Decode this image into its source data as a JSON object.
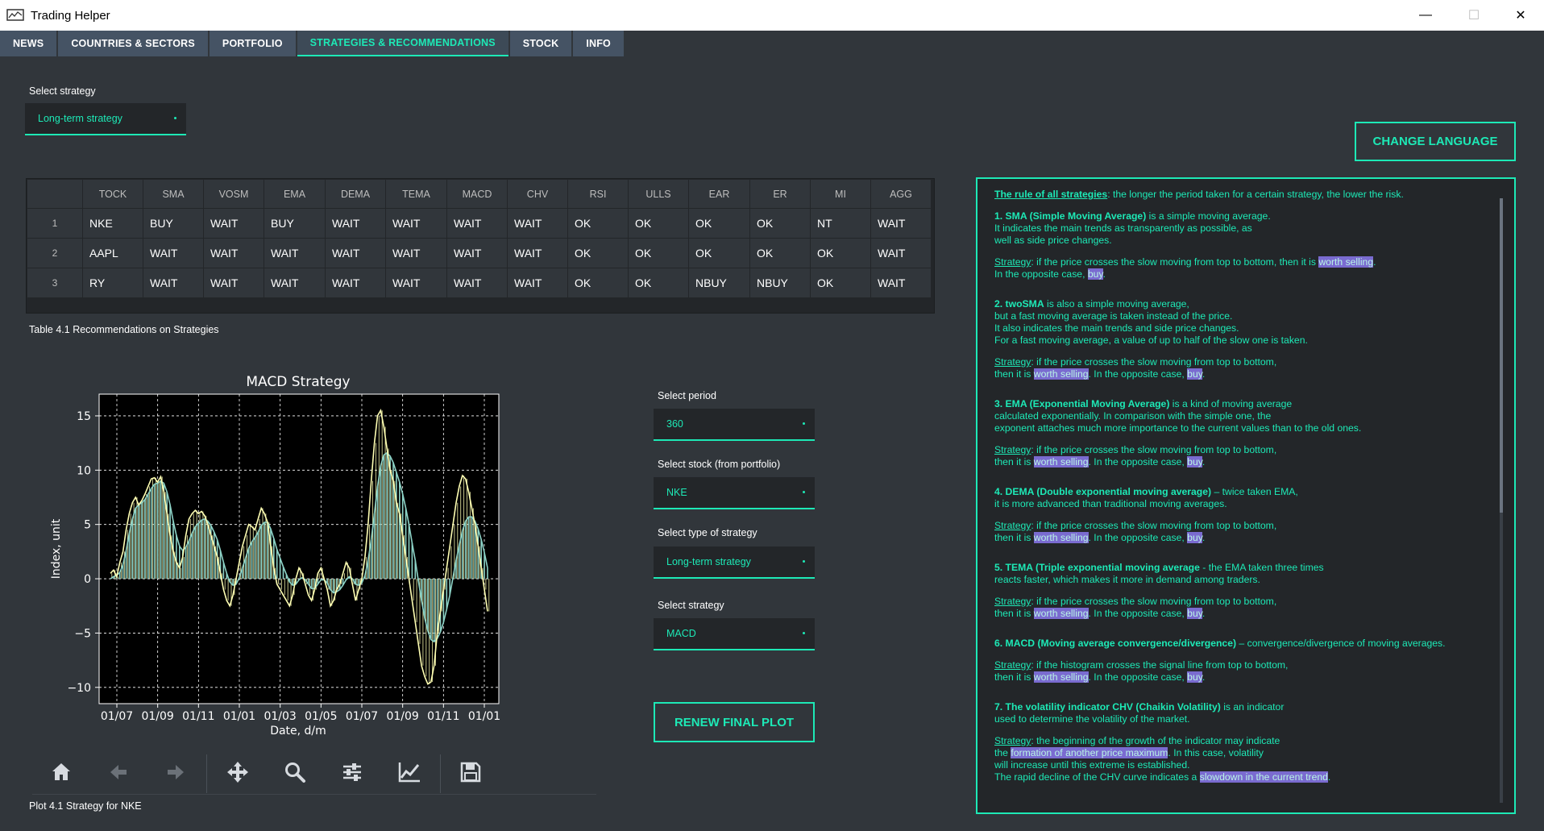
{
  "window": {
    "title": "Trading Helper",
    "controls": [
      "—",
      "☐",
      "✕"
    ]
  },
  "tabs": [
    {
      "label": "NEWS"
    },
    {
      "label": "COUNTRIES & SECTORS"
    },
    {
      "label": "PORTFOLIO"
    },
    {
      "label": "STRATEGIES & RECOMMENDATIONS"
    },
    {
      "label": "STOCK"
    },
    {
      "label": "INFO"
    }
  ],
  "strategy_selector": {
    "label": "Select strategy",
    "value": "Long-term strategy"
  },
  "table": {
    "headers": [
      "TOCK",
      "SMA",
      "VOSM",
      "EMA",
      "DEMA",
      "TEMA",
      "MACD",
      "CHV",
      "RSI",
      "ULLS",
      "EAR",
      "ER",
      "MI",
      "AGG"
    ],
    "rows": [
      {
        "num": "1",
        "cells": [
          "NKE",
          "BUY",
          "WAIT",
          "BUY",
          "WAIT",
          "WAIT",
          "WAIT",
          "WAIT",
          "OK",
          "OK",
          "OK",
          "OK",
          "NT",
          "WAIT"
        ]
      },
      {
        "num": "2",
        "cells": [
          "AAPL",
          "WAIT",
          "WAIT",
          "WAIT",
          "WAIT",
          "WAIT",
          "WAIT",
          "WAIT",
          "OK",
          "OK",
          "OK",
          "OK",
          "OK",
          "WAIT"
        ]
      },
      {
        "num": "3",
        "cells": [
          "RY",
          "WAIT",
          "WAIT",
          "WAIT",
          "WAIT",
          "WAIT",
          "WAIT",
          "WAIT",
          "OK",
          "OK",
          "NBUY",
          "NBUY",
          "OK",
          "WAIT"
        ]
      }
    ],
    "caption": "Table 4.1 Recommendations on Strategies"
  },
  "chart_data": {
    "type": "line",
    "title": "MACD Strategy",
    "xlabel": "Date, d/m",
    "ylabel": "Index, unit",
    "x_ticks": [
      "01/07",
      "01/09",
      "01/11",
      "01/01",
      "01/03",
      "01/05",
      "01/07",
      "01/09",
      "01/11",
      "01/01"
    ],
    "y_ticks": [
      15,
      10,
      5,
      0,
      -5,
      -10
    ],
    "ylim": [
      -11.5,
      17
    ],
    "grid": true,
    "background": "#000000",
    "series": [
      {
        "color": "#ffffb3",
        "values": [
          0.5,
          0.8,
          0.2,
          1.5,
          2.5,
          4.5,
          6.0,
          7.0,
          7.5,
          6.8,
          7.2,
          7.8,
          8.5,
          9.2,
          9.3,
          8.9,
          9.4,
          8.0,
          6.0,
          4.0,
          2.5,
          1.5,
          1.0,
          2.0,
          4.0,
          5.5,
          6.0,
          6.3,
          6.0,
          6.2,
          5.8,
          5.0,
          4.0,
          3.0,
          2.0,
          0.5,
          -1.0,
          -2.0,
          -2.5,
          -1.5,
          0.0,
          1.5,
          3.0,
          4.0,
          5.0,
          4.8,
          4.5,
          5.5,
          6.5,
          6.0,
          5.2,
          3.0,
          1.0,
          -0.5,
          -1.0,
          -1.5,
          -2.0,
          -2.5,
          -1.5,
          0.0,
          1.0,
          0.5,
          -0.5,
          -1.5,
          -2.0,
          -1.0,
          0.5,
          1.0,
          0.0,
          -1.0,
          -2.5,
          -2.0,
          -1.0,
          -0.5,
          0.5,
          1.5,
          1.0,
          -0.5,
          -2.0,
          -1.0,
          0.0,
          2.0,
          5.0,
          9.0,
          12.5,
          15.0,
          15.5,
          14.0,
          12.0,
          10.0,
          9.0,
          7.0,
          6.0,
          4.0,
          2.0,
          0.0,
          -2.0,
          -4.0,
          -6.0,
          -8.0,
          -9.0,
          -9.7,
          -9.5,
          -8.0,
          -5.0,
          -3.0,
          -1.0,
          1.0,
          3.0,
          5.0,
          7.0,
          8.5,
          9.5,
          9.2,
          8.0,
          6.5,
          5.0,
          3.0,
          1.0,
          -1.0,
          -3.0
        ]
      },
      {
        "color": "#8dd3c7",
        "values": [
          0.0,
          0.2,
          0.3,
          0.6,
          1.3,
          2.6,
          4.2,
          5.5,
          6.5,
          6.8,
          7.0,
          7.3,
          7.8,
          8.3,
          8.7,
          8.8,
          9.0,
          8.8,
          8.0,
          6.8,
          5.3,
          4.0,
          3.0,
          2.6,
          2.9,
          3.5,
          4.2,
          4.8,
          5.1,
          5.4,
          5.5,
          5.3,
          4.9,
          4.3,
          3.6,
          2.6,
          1.5,
          0.5,
          -0.3,
          -0.6,
          -0.5,
          0.1,
          1.0,
          1.9,
          2.8,
          3.4,
          3.8,
          4.3,
          4.9,
          5.2,
          5.2,
          4.6,
          3.7,
          2.7,
          1.9,
          1.1,
          0.4,
          -0.3,
          -0.6,
          -0.5,
          -0.1,
          0.1,
          -0.1,
          -0.5,
          -0.9,
          -0.9,
          -0.5,
          -0.1,
          -0.1,
          -0.4,
          -1.0,
          -1.3,
          -1.2,
          -1.0,
          -0.6,
          -0.1,
          0.2,
          0.0,
          -0.5,
          -0.6,
          -0.4,
          0.3,
          1.7,
          3.6,
          6.0,
          8.5,
          10.4,
          11.4,
          11.6,
          11.3,
          10.7,
          9.8,
          8.9,
          7.8,
          6.5,
          5.0,
          3.3,
          1.7,
          -0.2,
          -2.0,
          -3.6,
          -4.8,
          -5.6,
          -5.8,
          -5.5,
          -4.9,
          -4.0,
          -2.8,
          -1.5,
          0.1,
          1.7,
          3.1,
          4.4,
          5.3,
          5.7,
          5.7,
          5.3,
          4.6,
          3.6,
          2.4,
          1.0
        ]
      }
    ]
  },
  "controls": {
    "period": {
      "label": "Select period",
      "value": "360"
    },
    "stock": {
      "label": "Select stock (from portfolio)",
      "value": "NKE"
    },
    "type": {
      "label": "Select type of strategy",
      "value": "Long-term strategy"
    },
    "strategy": {
      "label": "Select strategy",
      "value": "MACD"
    },
    "renew_button": "RENEW FINAL PLOT"
  },
  "plot_caption": "Plot 4.1 Strategy for NKE",
  "change_language_button": "CHANGE LANGUAGE",
  "toolbar_icons": [
    "home-icon",
    "back-arrow-icon",
    "forward-arrow-icon",
    "pan-icon",
    "zoom-icon",
    "configure-icon",
    "edit-curve-icon",
    "save-icon"
  ],
  "rules": {
    "intro_title": "The rule of all strategies",
    "intro_text": ": the longer the period taken for a certain strategy, the lower the risk.",
    "sma_title": "1. SMA (Simple Moving Average)",
    "sma_l1": " is a simple moving average.",
    "sma_l2": "It indicates the main trends as transparently as possible, as",
    "sma_l3": "well as side price changes.",
    "s1_a": "Strategy",
    "s1_b": ": if the price crosses the slow moving from top to bottom, then it is ",
    "s1_hl": "worth selling",
    "s1_c": ".",
    "s1_d": "In the opposite case, ",
    "s1_buy": "buy",
    "s1_e": ".",
    "two_title": "2. twoSMA",
    "two_l1": " is also a simple moving average,",
    "two_l2": "but a fast moving average is taken instead of the price.",
    "two_l3": "It also indicates the main trends and side price changes.",
    "two_l4": "For a fast moving average, a value of up to half of the slow one is taken.",
    "str_label": "Strategy",
    "str_text": ": if the price crosses the slow moving from top to bottom,",
    "str_then": "then it is ",
    "str_sell": "worth selling",
    "str_opp": ". In the opposite case, ",
    "str_buy": "buy",
    "str_dot": ".",
    "ema_title": "3. EMA (Exponential Moving Average)",
    "ema_l1": " is a kind of moving average",
    "ema_l2": "calculated exponentially. In comparison with the simple one, the",
    "ema_l3": "exponent attaches much more importance to the current values than to the old ones.",
    "dema_title": "4. DEMA (Double exponential moving average)",
    "dema_l1": " – twice taken EMA,",
    "dema_l2": "it is more advanced than traditional moving averages.",
    "tema_title": "5. TEMA (Triple exponential moving average",
    "tema_l1": " - the EMA taken three times",
    "tema_l2": "reacts faster, which makes it more in demand among traders.",
    "macd_title": "6. MACD (Moving average convergence/divergence)",
    "macd_l1": " – convergence/divergence of moving averages.",
    "macd_str": ": if the histogram crosses the signal line from top to bottom,",
    "chv_title": "7. The volatility indicator CHV (Chaikin Volatility)",
    "chv_l1": " is an indicator",
    "chv_l2": "used to determine the volatility of the market.",
    "chv_str": ": the beginning of the growth of the indicator may indicate",
    "chv_the": "the ",
    "chv_hl1": "formation of another price maximum",
    "chv_l3": ". In this case, volatility",
    "chv_l4": "will increase until this extreme is established.",
    "chv_l5": "The rapid decline of the CHV curve indicates a ",
    "chv_hl2": "slowdown in the current trend",
    "chv_end": "."
  }
}
